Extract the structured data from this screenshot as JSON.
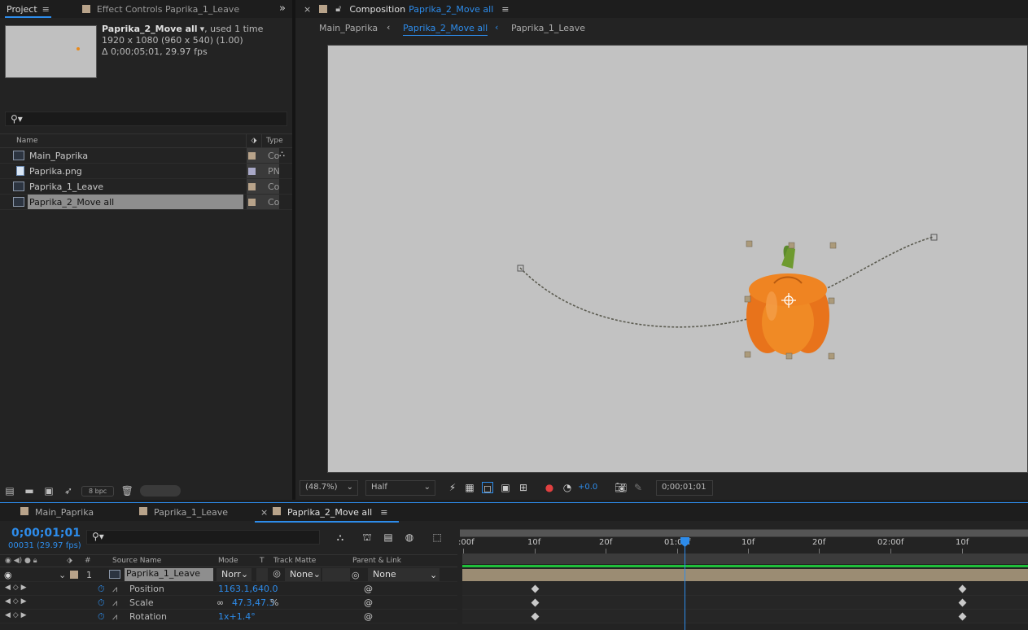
{
  "project_panel": {
    "tabs": [
      {
        "label": "Project",
        "menu": "≡"
      },
      {
        "label": "Effect Controls Paprika_1_Leave"
      }
    ],
    "expand_glyph": "»",
    "info": {
      "name": "Paprika_2_Move all",
      "usage": ", used 1 time",
      "resolution": "1920 x 1080  (960 x 540) (1.00)",
      "duration": "Δ 0;00;05;01, 29.97 fps"
    },
    "search_glyph": "⚲▾",
    "columns": {
      "name": "Name",
      "type": "Type"
    },
    "items": [
      {
        "label": "Main_Paprika",
        "type": "Co",
        "icon": "composition-icon"
      },
      {
        "label": "Paprika.png",
        "type": "PN",
        "icon": "png-file-icon"
      },
      {
        "label": "Paprika_1_Leave",
        "type": "Co",
        "icon": "composition-icon"
      },
      {
        "label": "Paprika_2_Move all",
        "type": "Co",
        "icon": "composition-icon",
        "selected": true
      }
    ],
    "footer": {
      "bpc": "8 bpc"
    }
  },
  "comp_panel": {
    "tab_prefix": "Composition",
    "tab_name": "Paprika_2_Move all",
    "breadcrumbs": [
      "Main_Paprika",
      "Paprika_2_Move all",
      "Paprika_1_Leave"
    ],
    "toolbar": {
      "zoom": "(48.7%)",
      "resolution": "Half",
      "exposure": "+0.0",
      "timecode": "0;00;01;01"
    }
  },
  "timeline": {
    "tabs": [
      "Main_Paprika",
      "Paprika_1_Leave",
      "Paprika_2_Move all"
    ],
    "current_time": "0;00;01;01",
    "frame_info": "00031 (29.97 fps)",
    "columns": {
      "number": "#",
      "source": "Source Name",
      "mode": "Mode",
      "t": "T",
      "matte": "Track Matte",
      "parent": "Parent & Link"
    },
    "layer": {
      "index": "1",
      "name": "Paprika_1_Leave",
      "mode": "Norr",
      "matte": "None",
      "parent": "None"
    },
    "properties": [
      {
        "name": "Position",
        "value": "1163.1,640.0"
      },
      {
        "name": "Scale",
        "value": "47.3,47.3",
        "unit": "%"
      },
      {
        "name": "Rotation",
        "value": "1x+1.4°"
      }
    ],
    "ruler_labels": [
      ":00f",
      "10f",
      "20f",
      "01:00f",
      "10f",
      "20f",
      "02:00f",
      "10f"
    ],
    "colors": {
      "accent": "#2d8ceb",
      "label_sand": "#b8a38a",
      "work_area": "#1fbf3a"
    }
  }
}
